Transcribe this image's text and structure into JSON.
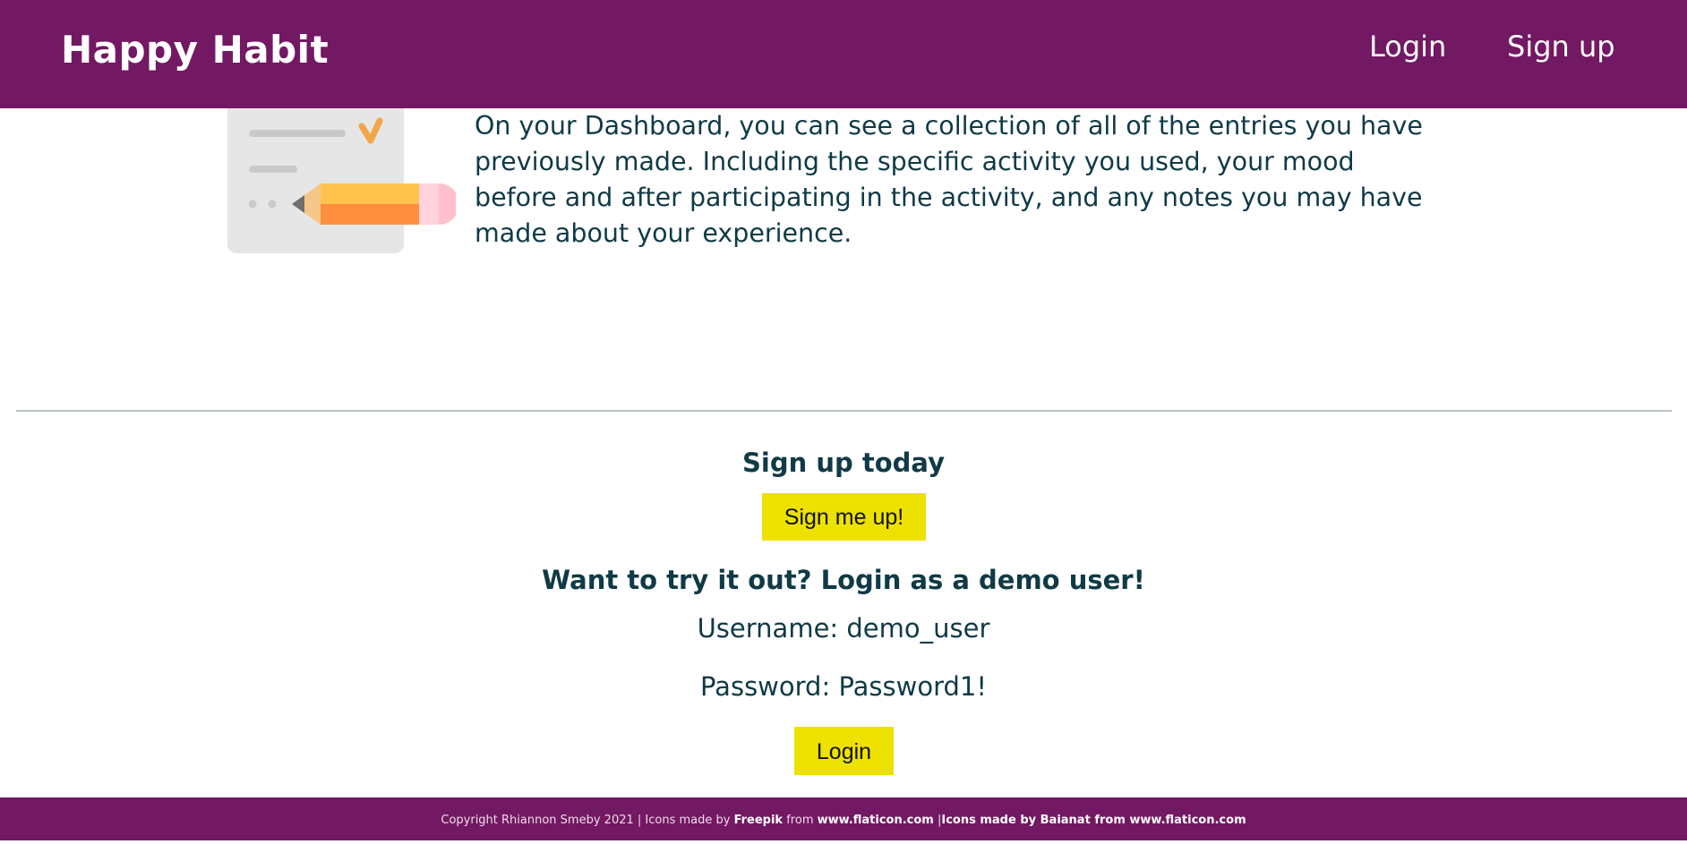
{
  "nav": {
    "brand": "Happy Habit",
    "login_label": "Login",
    "signup_label": "Sign up"
  },
  "feature": {
    "icon": "clipboard-pencil-icon",
    "text": "On your Dashboard, you can see a collection of all of the entries you have previously made. Including the specific activity you used, your mood before and after participating in the activity, and any notes you may have made about your experience."
  },
  "signup_section": {
    "heading": "Sign up today",
    "button_label": "Sign me up!"
  },
  "demo_section": {
    "heading": "Want to try it out? Login as a demo user!",
    "username_line": "Username: demo_user",
    "password_line": "Password: Password1!",
    "button_label": "Login"
  },
  "footer": {
    "copyright": "Copyright Rhiannon Smeby 2021 |  Icons made by ",
    "freepik": "Freepik",
    "from1": " from ",
    "site1": "www.flaticon.com",
    "separator": " |",
    "icons_by_baianat": "Icons made by Baianat from www.flaticon.com"
  },
  "colors": {
    "brand_purple": "#731862",
    "button_yellow": "#ede100",
    "text_dark_teal": "#0f3a46"
  }
}
